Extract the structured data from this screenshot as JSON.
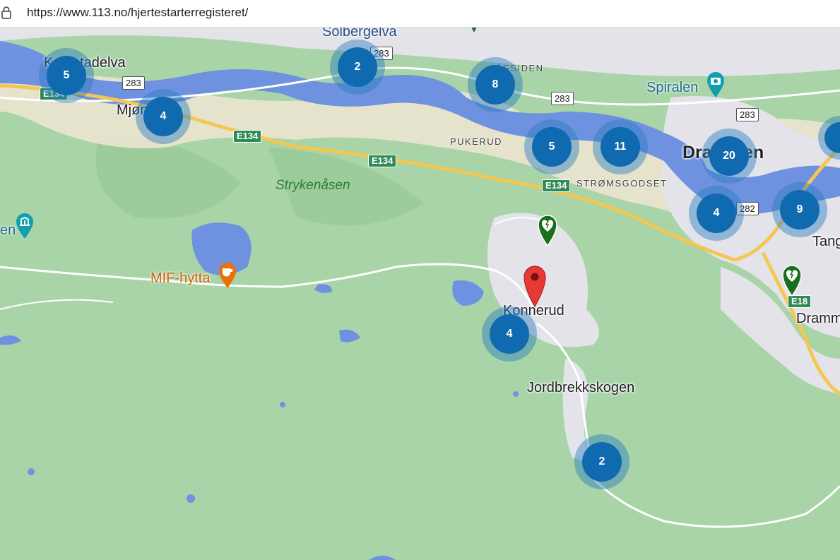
{
  "browser": {
    "url": "https://www.113.no/hjertestarterregisteret/"
  },
  "clusters": [
    {
      "id": "krokstadelva",
      "count": "5"
    },
    {
      "id": "solbergelva",
      "count": "2"
    },
    {
      "id": "assiden",
      "count": "8"
    },
    {
      "id": "mjondalen",
      "count": "4"
    },
    {
      "id": "pukerud",
      "count": "5"
    },
    {
      "id": "stromsgodset",
      "count": "11"
    },
    {
      "id": "drammen",
      "count": "20"
    },
    {
      "id": "drammen-south",
      "count": "4"
    },
    {
      "id": "tangen",
      "count": "9"
    },
    {
      "id": "konnerud",
      "count": "4"
    },
    {
      "id": "jordbrekkskogen",
      "count": "2"
    }
  ],
  "places": {
    "krokstadelva": "Krokstadelva",
    "solbergelva": "Solbergelva",
    "mjondalen": "Mjøndalen",
    "assiden": "ÅSSIDEN",
    "pukerud": "PUKERUD",
    "stromsgodset": "STRØMSGODSET",
    "drammen": "Drammen",
    "spiralen": "Spiralen",
    "strykenasen": "Strykenåsen",
    "mif_hytta": "MIF-hytta",
    "konnerud": "Konnerud",
    "jordbrekkskogen": "Jordbrekkskogen",
    "tang": "Tang",
    "dramm": "Dramm",
    "en_fragment": "en"
  },
  "road_shields": {
    "r283a": "283",
    "r283b": "283",
    "r283c": "283",
    "r283d": "283",
    "r282": "282",
    "e134a": "E134",
    "e134b": "E134",
    "e134c": "E134",
    "e134d": "E134",
    "e18": "E18"
  },
  "markers": {
    "aed_1": "aed-marker",
    "aed_2": "aed-marker",
    "location_pin": "red-location-pin"
  },
  "colors": {
    "land": "#a6d3a6",
    "urban": "#e4e3ea",
    "water": "#6e92e0",
    "cluster": "#106ab0",
    "aed_marker": "#1b6e1b",
    "location_pin": "#e53935",
    "highway": "#f4c752"
  }
}
